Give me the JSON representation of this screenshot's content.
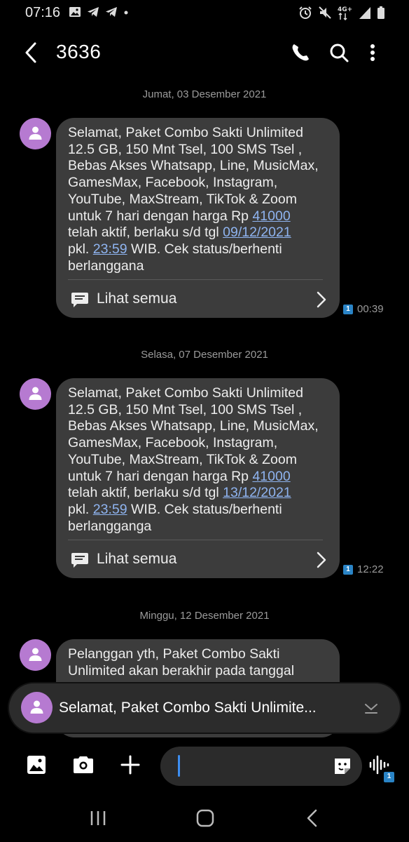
{
  "status_bar": {
    "time": "07:16",
    "icons": [
      "gallery-notification-icon",
      "telegram-icon",
      "telegram-icon",
      "dot-icon",
      "alarm-icon",
      "mute-icon",
      "network-4g-icon",
      "signal-icon",
      "battery-icon"
    ],
    "network_label": "4G+"
  },
  "header": {
    "title": "3636",
    "actions": [
      "phone-icon",
      "search-icon",
      "more-icon"
    ]
  },
  "conversation": {
    "days": [
      {
        "date": "Jumat, 03 Desember 2021"
      },
      {
        "date": "Selasa, 07 Desember 2021"
      },
      {
        "date": "Minggu, 12 Desember 2021"
      }
    ],
    "messages": [
      {
        "pre": "Selamat, Paket Combo Sakti Unlimited\n12.5 GB, 150 Mnt Tsel, 100 SMS Tsel ,\nBebas Akses Whatsapp, Line, MusicMax,\nGamesMax, Facebook, Instagram,\nYouTube, MaxStream, TikTok & Zoom\nuntuk 7 hari dengan harga Rp ",
        "price": "41000",
        "mid": "\ntelah aktif, berlaku s/d tgl ",
        "until": "09/12/2021",
        "mid2": "\npkl. ",
        "clock": "23:59",
        "post": " WIB. Cek status/berhenti\nberlanggana",
        "see_all": "Lihat semua",
        "sim": "1",
        "time": "00:39"
      },
      {
        "pre": "Selamat, Paket Combo Sakti Unlimited\n12.5 GB, 150 Mnt Tsel, 100 SMS Tsel ,\nBebas Akses Whatsapp, Line, MusicMax,\nGamesMax, Facebook, Instagram,\nYouTube, MaxStream, TikTok & Zoom\nuntuk 7 hari dengan harga Rp ",
        "price": "41000",
        "mid": "\ntelah aktif, berlaku s/d tgl ",
        "until": "13/12/2021",
        "mid2": "\npkl. ",
        "clock": "23:59",
        "post": " WIB. Cek status/berhenti\nberlangganga",
        "see_all": "Lihat semua",
        "sim": "1",
        "time": "12:22"
      },
      {
        "text": "Pelanggan yth, Paket Combo Sakti\nUnlimited akan berakhir pada tanggal"
      }
    ]
  },
  "popup": {
    "text": "Selamat, Paket Combo Sakti Unlimite..."
  },
  "composer": {
    "placeholder": "",
    "left_icons": [
      "gallery-icon",
      "camera-icon",
      "add-icon"
    ],
    "right_icons": [
      "sticker-icon",
      "voice-record-icon"
    ],
    "sim_badge": "1"
  },
  "nav": [
    "recent-apps-icon",
    "home-icon",
    "back-icon"
  ],
  "colors": {
    "background": "#000000",
    "bubble": "#3c3c3c",
    "avatar": "#b67ad1",
    "link": "#8fb4f0",
    "cursor": "#3d8ef0",
    "sim_badge": "#2a84c6"
  }
}
